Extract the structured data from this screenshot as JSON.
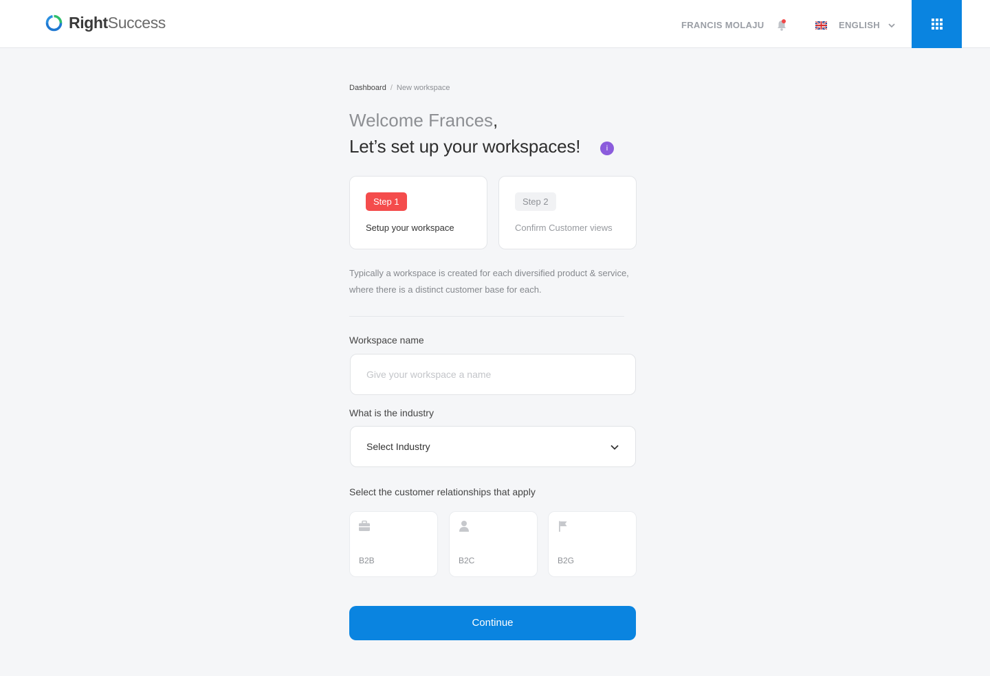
{
  "header": {
    "logo_bold": "Right",
    "logo_light": "Success",
    "user_name": "FRANCIS MOLAJU",
    "language": "ENGLISH",
    "icons": {
      "logo": "ring-logo-icon",
      "notifications": "bell-icon",
      "flag": "uk-flag-icon",
      "language_chevron": "chevron-down-icon",
      "apps": "grid-icon"
    },
    "accent": "#0a84e0",
    "notification_dot_color": "#f04848"
  },
  "breadcrumb": {
    "link": "Dashboard",
    "separator": "/",
    "current": "New workspace"
  },
  "greeting": {
    "welcome": "Welcome Frances",
    "comma": ",",
    "headline": "Let’s set up your workspaces!",
    "info_symbol": "i"
  },
  "steps": [
    {
      "badge": "Step 1",
      "title": "Setup your workspace",
      "active": true
    },
    {
      "badge": "Step 2",
      "title": "Confirm Customer views",
      "active": false
    }
  ],
  "description": "Typically a workspace is created for each diversified product & service, where there is a distinct customer base for each.",
  "form": {
    "name_label": "Workspace name",
    "name_placeholder": "Give your workspace a name",
    "name_value": "",
    "industry_label": "What is the industry",
    "industry_value": "Select Industry",
    "relationships_label": "Select the customer relationships that apply",
    "relationships": [
      {
        "label": "B2B",
        "icon": "briefcase-icon"
      },
      {
        "label": "B2C",
        "icon": "person-icon"
      },
      {
        "label": "B2G",
        "icon": "flag-icon"
      }
    ],
    "continue_label": "Continue"
  }
}
